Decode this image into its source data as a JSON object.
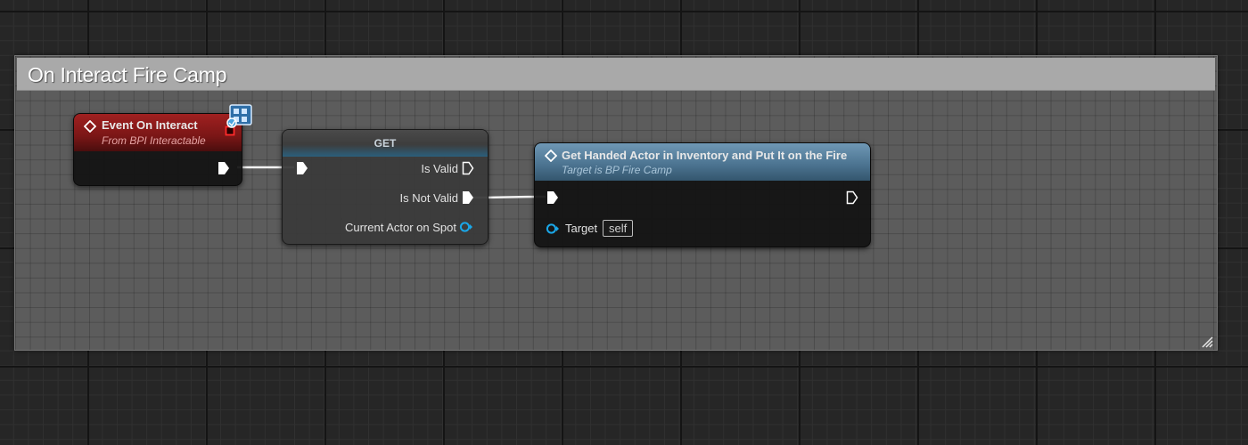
{
  "comment": {
    "title": "On Interact Fire Camp"
  },
  "event_node": {
    "title": "Event On Interact",
    "subtitle": "From BPI Interactable"
  },
  "get_node": {
    "title": "GET",
    "pins": {
      "is_valid": "Is Valid",
      "is_not_valid": "Is Not Valid",
      "current_actor": "Current Actor on Spot"
    }
  },
  "function_node": {
    "title": "Get Handed Actor in Inventory and Put It on the Fire",
    "subtitle": "Target is BP Fire Camp",
    "target_label": "Target",
    "target_value": "self"
  },
  "colors": {
    "event_header": "#8b1a1a",
    "function_header": "#4d7592",
    "object_pin": "#1aa7e8",
    "exec_pin": "#ffffff"
  }
}
